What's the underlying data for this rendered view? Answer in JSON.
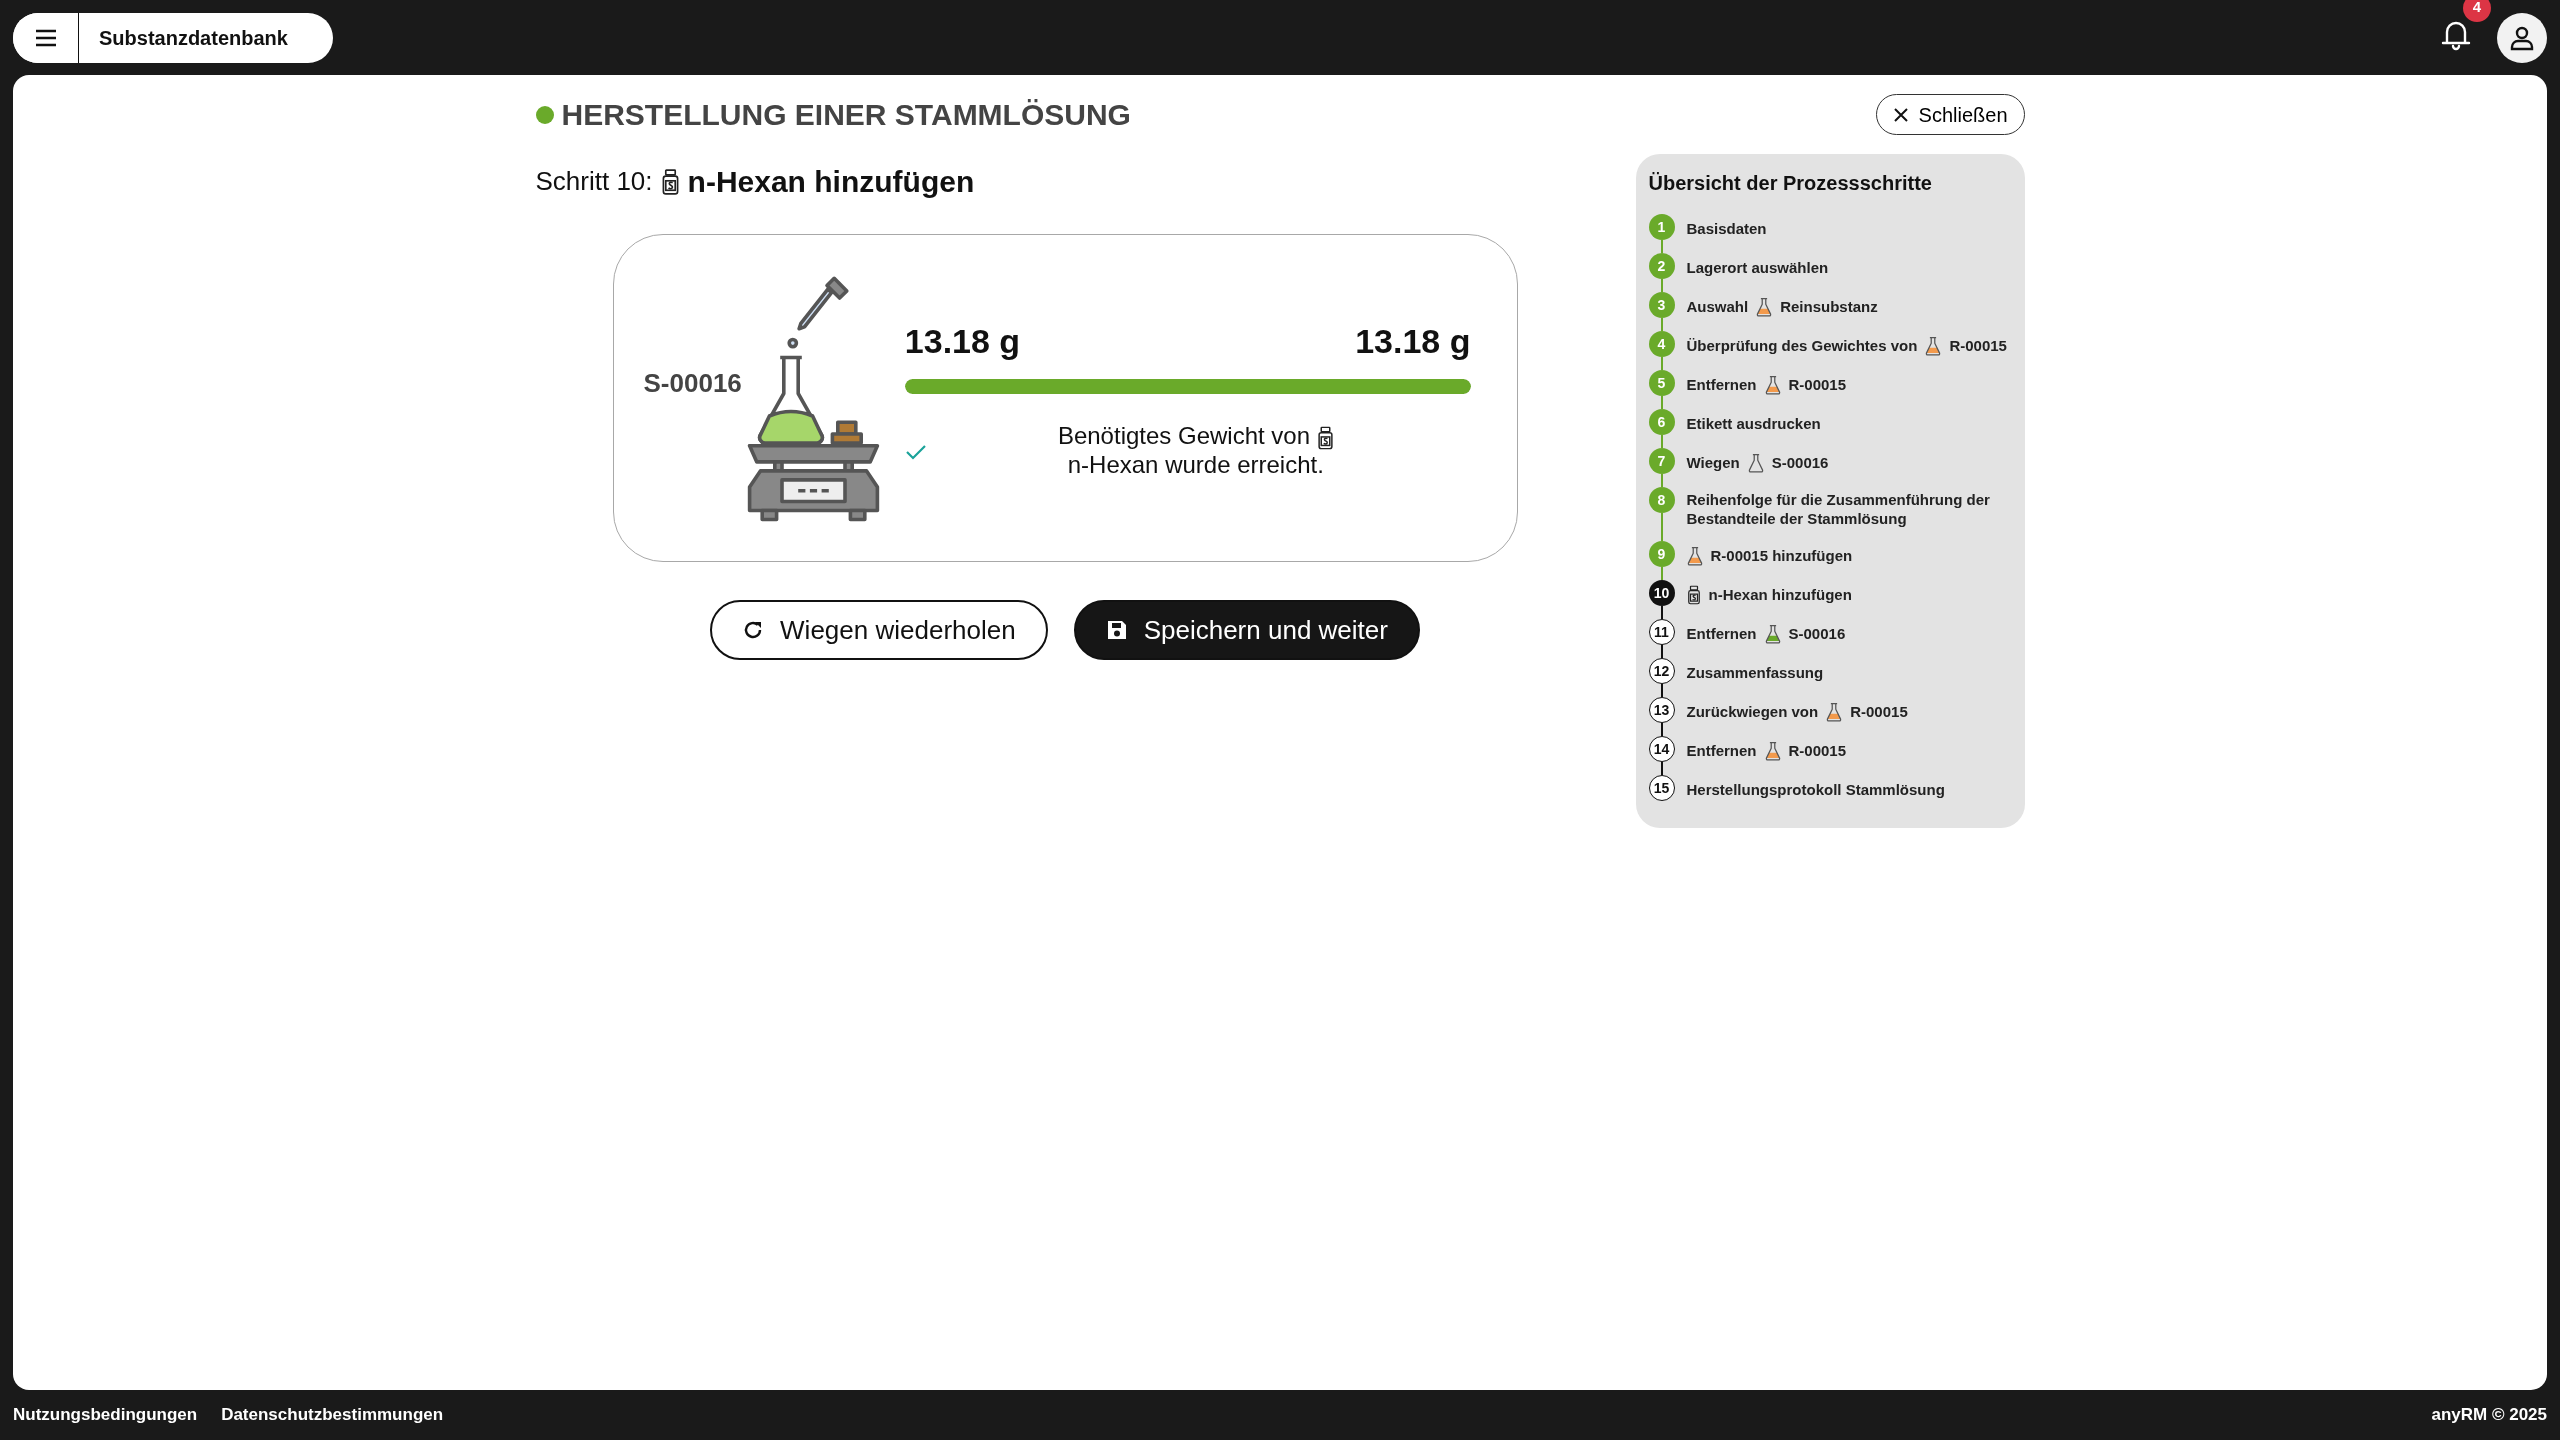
{
  "topbar": {
    "app_title": "Substanzdatenbank",
    "notification_count": "4"
  },
  "header": {
    "title": "HERSTELLUNG EINER STAMMLÖSUNG",
    "close_label": "Schließen"
  },
  "step": {
    "prefix": "Schritt 10:",
    "name": "n-Hexan hinzufügen"
  },
  "weighing": {
    "sample_label": "S-00016",
    "current": "13.18 g",
    "target": "13.18 g",
    "level": 1,
    "success": true,
    "message": [
      {
        "kind": "text",
        "text": "Benötigtes Gewicht von"
      },
      {
        "kind": "jar"
      },
      {
        "kind": "text",
        "text": "n-Hexan wurde erreicht."
      }
    ]
  },
  "buttons": [
    {
      "kind": "repeat",
      "label": "Wiegen wiederholen"
    },
    {
      "kind": "save",
      "label": "Speichern und weiter"
    }
  ],
  "overview": {
    "title": "Übersicht der Prozessschritte",
    "steps": [
      {
        "number": "1",
        "done": true,
        "current": false,
        "parts": [
          {
            "kind": "text",
            "text": "Basisdaten"
          }
        ]
      },
      {
        "number": "2",
        "done": true,
        "current": false,
        "parts": [
          {
            "kind": "text",
            "text": "Lagerort auswählen"
          }
        ]
      },
      {
        "number": "3",
        "done": true,
        "current": false,
        "parts": [
          {
            "kind": "text",
            "text": "Auswahl"
          },
          {
            "kind": "flask",
            "color": "#f39a4c"
          },
          {
            "kind": "text",
            "text": "Reinsubstanz"
          }
        ]
      },
      {
        "number": "4",
        "done": true,
        "current": false,
        "parts": [
          {
            "kind": "text",
            "text": "Überprüfung des Gewichtes von"
          },
          {
            "kind": "flask",
            "color": "#f39a4c"
          },
          {
            "kind": "text",
            "text": "R-00015"
          }
        ]
      },
      {
        "number": "5",
        "done": true,
        "current": false,
        "parts": [
          {
            "kind": "text",
            "text": "Entfernen"
          },
          {
            "kind": "flask",
            "color": "#f39a4c"
          },
          {
            "kind": "text",
            "text": "R-00015"
          }
        ]
      },
      {
        "number": "6",
        "done": true,
        "current": false,
        "parts": [
          {
            "kind": "text",
            "text": "Etikett ausdrucken"
          }
        ]
      },
      {
        "number": "7",
        "done": true,
        "current": false,
        "parts": [
          {
            "kind": "text",
            "text": "Wiegen"
          },
          {
            "kind": "flask"
          },
          {
            "kind": "text",
            "text": "S-00016"
          }
        ]
      },
      {
        "number": "8",
        "done": true,
        "current": false,
        "parts": [
          {
            "kind": "text",
            "text": "Reihenfolge für die Zusammenführung der Bestandteile der Stammlösung"
          }
        ]
      },
      {
        "number": "9",
        "done": true,
        "current": false,
        "parts": [
          {
            "kind": "flask",
            "color": "#f39a4c"
          },
          {
            "kind": "text",
            "text": "R-00015 hinzufügen"
          }
        ]
      },
      {
        "number": "10",
        "done": false,
        "current": true,
        "parts": [
          {
            "kind": "jar"
          },
          {
            "kind": "text",
            "text": "n-Hexan hinzufügen"
          }
        ]
      },
      {
        "number": "11",
        "done": false,
        "current": false,
        "parts": [
          {
            "kind": "text",
            "text": "Entfernen"
          },
          {
            "kind": "flask",
            "color": "#6aaa2a"
          },
          {
            "kind": "text",
            "text": "S-00016"
          }
        ]
      },
      {
        "number": "12",
        "done": false,
        "current": false,
        "parts": [
          {
            "kind": "text",
            "text": "Zusammenfassung"
          }
        ]
      },
      {
        "number": "13",
        "done": false,
        "current": false,
        "parts": [
          {
            "kind": "text",
            "text": "Zurückwiegen von"
          },
          {
            "kind": "flask",
            "color": "#f39a4c"
          },
          {
            "kind": "text",
            "text": "R-00015"
          }
        ]
      },
      {
        "number": "14",
        "done": false,
        "current": false,
        "parts": [
          {
            "kind": "text",
            "text": "Entfernen"
          },
          {
            "kind": "flask",
            "color": "#f39a4c"
          },
          {
            "kind": "text",
            "text": "R-00015"
          }
        ]
      },
      {
        "number": "15",
        "done": false,
        "current": false,
        "parts": [
          {
            "kind": "text",
            "text": "Herstellungsprotokoll Stammlösung"
          }
        ]
      }
    ]
  },
  "footer": {
    "links": [
      "Nutzungsbedingungen",
      "Datenschutzbestimmungen"
    ],
    "copyright": "anyRM © 2025"
  }
}
